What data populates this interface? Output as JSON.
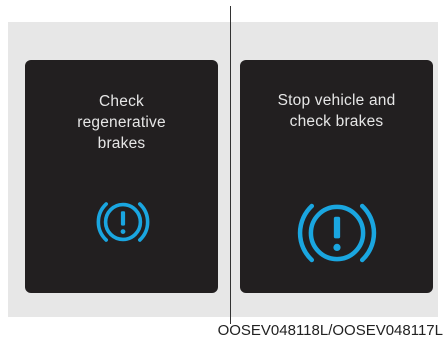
{
  "left_panel": {
    "message": "Check\nregenerative\nbrakes",
    "icon": "brake-warning-icon"
  },
  "right_panel": {
    "message": "Stop vehicle and\ncheck brakes",
    "icon": "brake-warning-icon"
  },
  "caption": "OOSEV048118L/OOSEV048117L",
  "colors": {
    "screen_bg": "#221f20",
    "text": "#e6e6e6",
    "icon": "#1aa6e0",
    "panel_bg": "#e7e7e7"
  }
}
